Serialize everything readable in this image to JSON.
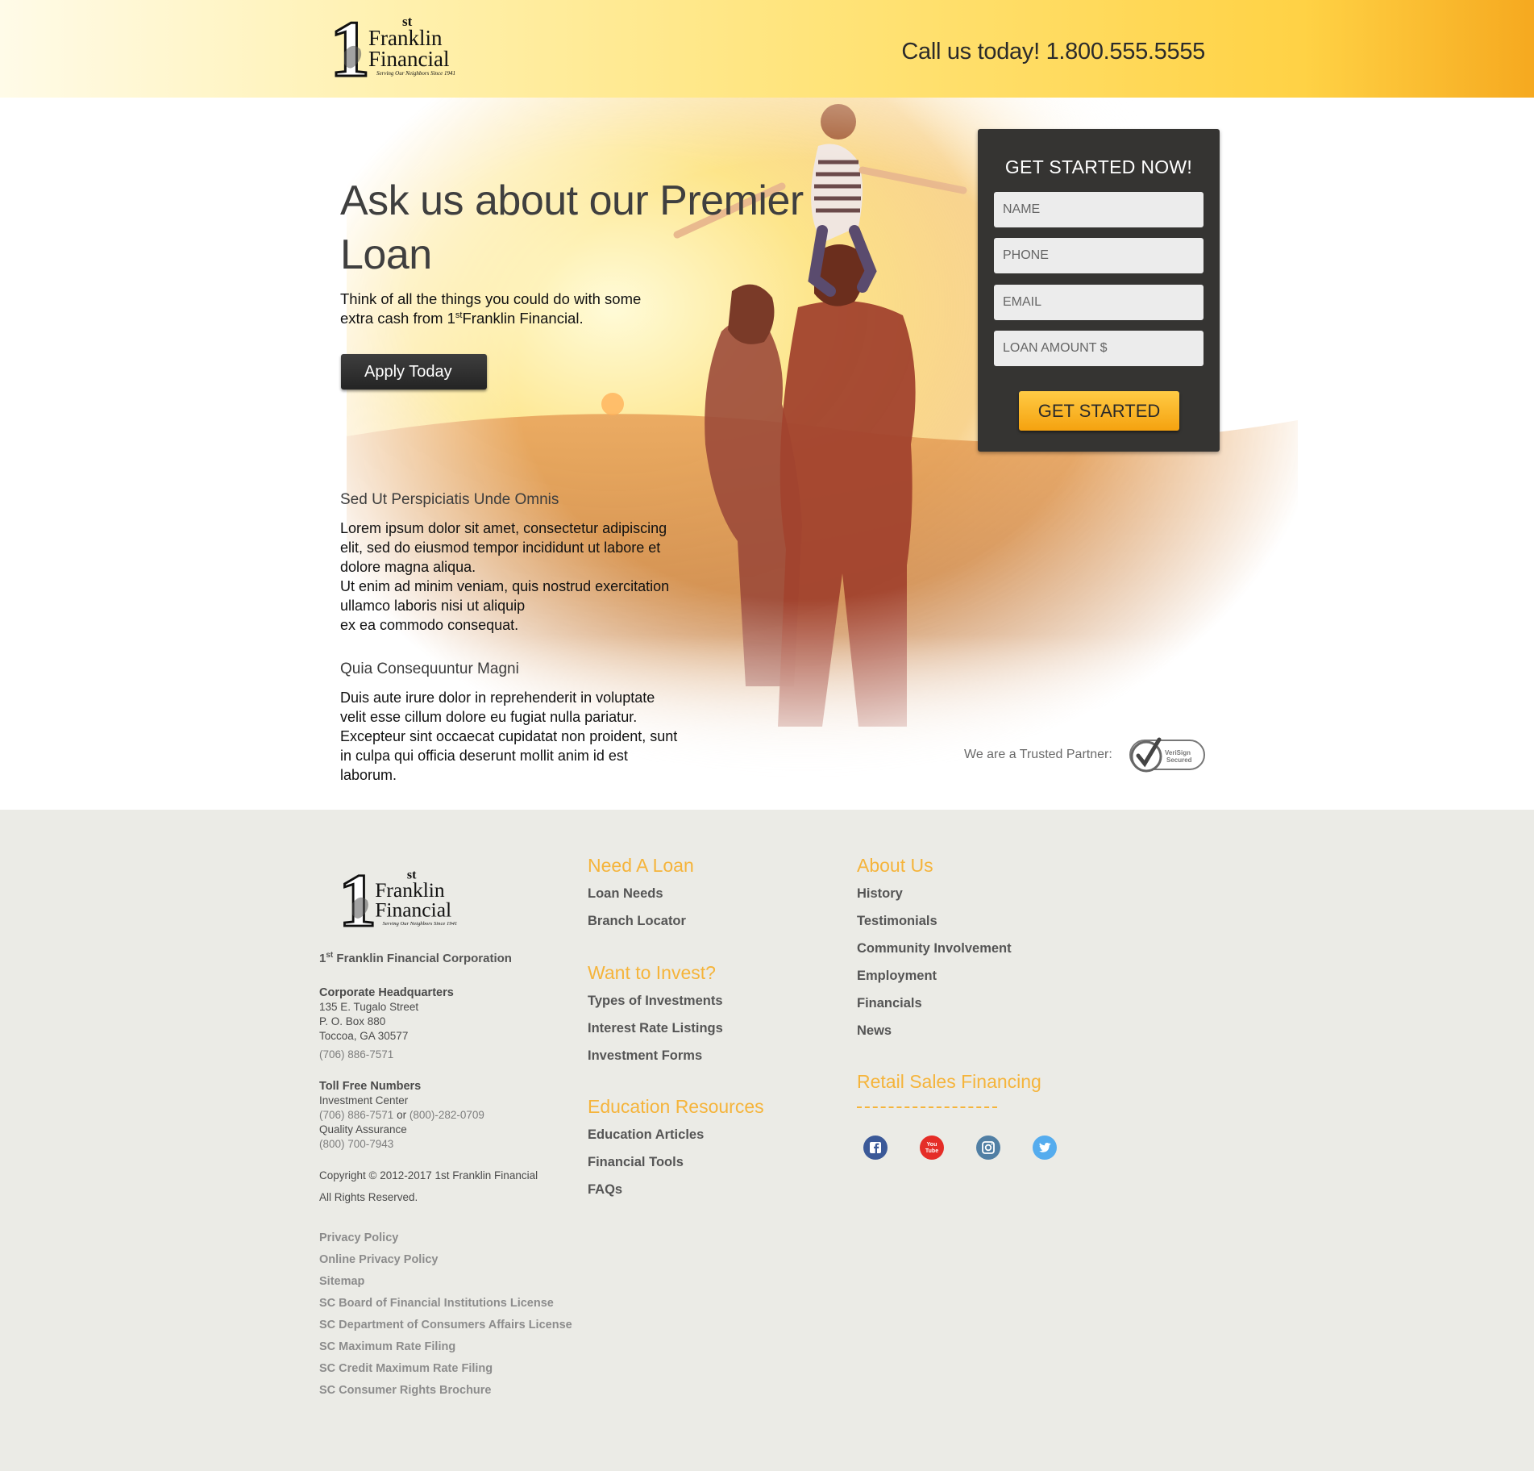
{
  "header": {
    "logo_number": "1",
    "logo_superscript": "st",
    "logo_line1": "Franklin",
    "logo_line2": "Financial",
    "logo_tagline": "Serving Our Neighbors Since 1941",
    "phone": "Call us today! 1.800.555.5555"
  },
  "hero": {
    "title": "Ask us about our Premier Loan",
    "subtitle_pre": "Think of all the things you could do with some extra cash from 1",
    "subtitle_sup": "st",
    "subtitle_post": "Franklin Financial.",
    "apply_label": "Apply Today"
  },
  "form": {
    "title": "GET STARTED NOW!",
    "name_placeholder": "NAME",
    "phone_placeholder": "PHONE",
    "email_placeholder": "EMAIL",
    "loan_placeholder": "LOAN AMOUNT $",
    "submit_label": "GET STARTED"
  },
  "content": {
    "section1_title": "Sed Ut Perspiciatis Unde Omnis",
    "section1_lines": [
      "Lorem ipsum dolor sit amet, consectetur adipiscing",
      "elit, sed do eiusmod tempor incididunt ut labore et",
      "dolore magna aliqua.",
      "Ut enim ad minim veniam, quis nostrud exercitation",
      "ullamco laboris nisi ut aliquip",
      "ex ea commodo consequat."
    ],
    "section2_title": "Quia Consequuntur Magni",
    "section2_lines": [
      "Duis aute irure dolor in reprehenderit in voluptate",
      "velit esse cillum dolore eu fugiat nulla pariatur.",
      "Excepteur sint occaecat cupidatat non proident, sunt",
      "in culpa qui officia deserunt mollit anim id est",
      "laborum."
    ],
    "trusted_label": "We are a Trusted Partner:",
    "verisign_line1": "VeriSign",
    "verisign_line2": "Secured"
  },
  "footer": {
    "corp_pre": "1",
    "corp_sup": "st",
    "corp_post": "Franklin Financial Corporation",
    "hq_title": "Corporate Headquarters",
    "hq_address": [
      "135 E. Tugalo Street",
      "P. O. Box 880",
      "Toccoa, GA 30577"
    ],
    "hq_phone": "(706) 886-7571",
    "toll_title": "Toll Free Numbers",
    "investment_label": "Investment Center",
    "investment_phone1": "(706) 886-7571",
    "investment_or": "or",
    "investment_phone2": "(800)-282-0709",
    "qa_label": "Quality Assurance",
    "qa_phone": "(800) 700-7943",
    "copyright": "Copyright © 2012-2017 1st Franklin Financial",
    "rights": "All Rights Reserved.",
    "legal_links": [
      "Privacy Policy",
      "Online Privacy Policy",
      "Sitemap",
      "SC Board of Financial Institutions License",
      "SC Department of Consumers Affairs License",
      "SC Maximum Rate Filing",
      "SC Credit Maximum Rate Filing",
      "SC Consumer Rights Brochure"
    ],
    "need_loan": {
      "title": "Need A Loan",
      "links": [
        "Loan Needs",
        "Branch Locator"
      ]
    },
    "invest": {
      "title": "Want to Invest?",
      "links": [
        "Types of Investments",
        "Interest Rate Listings",
        "Investment Forms"
      ]
    },
    "education": {
      "title": "Education Resources",
      "links": [
        "Education Articles",
        "Financial Tools",
        "FAQs"
      ]
    },
    "about": {
      "title": "About Us",
      "links": [
        "History",
        "Testimonials",
        "Community Involvement",
        "Employment",
        "Financials",
        "News"
      ]
    },
    "retail_title": "Retail Sales Financing",
    "social": [
      {
        "icon": "facebook-icon",
        "color": "#3b5998"
      },
      {
        "icon": "youtube-icon",
        "color": "#e52d27",
        "text_line1": "You",
        "text_line2": "Tube"
      },
      {
        "icon": "instagram-icon",
        "color": "#517fa4"
      },
      {
        "icon": "twitter-icon",
        "color": "#55acee"
      }
    ]
  },
  "colors": {
    "header_gradient_start": "#fffbe8",
    "header_gradient_end": "#f6a91f",
    "form_panel": "#353432",
    "accent_orange": "#f5b43b",
    "footer_bg": "#ebebe6"
  }
}
